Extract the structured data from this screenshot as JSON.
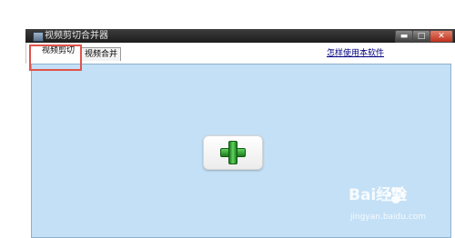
{
  "window": {
    "title": "视频剪切合并器",
    "controls": {
      "minimize": "▬",
      "maximize": "□",
      "close": "✕"
    }
  },
  "tabs": [
    {
      "label": "视频剪切",
      "active": true
    },
    {
      "label": "视频合并",
      "active": false
    }
  ],
  "help_link": "怎样使用本软件",
  "main": {
    "add_button_icon": "plus-icon"
  },
  "watermark": {
    "main": "Bai经验",
    "sub": "jingyan.baidu.com"
  },
  "colors": {
    "content_bg": "#c4e0f6",
    "highlight": "#e0534a",
    "plus_green": "#3fbf3f"
  }
}
